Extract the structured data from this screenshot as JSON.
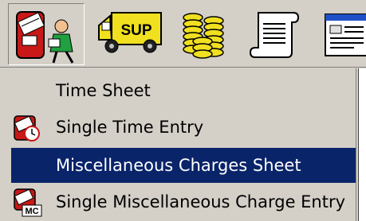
{
  "toolbar": {
    "buttons": [
      {
        "icon": "timesheet-mail-icon",
        "pressed": true
      },
      {
        "icon": "supply-truck-icon",
        "badge_text": "SUP"
      },
      {
        "icon": "coin-stacks-icon"
      },
      {
        "icon": "scroll-document-icon"
      },
      {
        "icon": "form-document-icon"
      }
    ]
  },
  "menu": {
    "items": [
      {
        "label": "Time Sheet",
        "icon": null,
        "selected": false
      },
      {
        "label": "Single Time Entry",
        "icon": "single-time-entry-icon",
        "selected": false
      },
      {
        "label": "Miscellaneous Charges Sheet",
        "icon": null,
        "selected": true
      },
      {
        "label": "Single Miscellaneous Charge Entry",
        "icon": "single-misc-charge-icon",
        "icon_text": "MC",
        "selected": false
      }
    ]
  },
  "colors": {
    "face": "#d4d0c8",
    "highlight": "#0a246a",
    "highlight_text": "#ffffff"
  }
}
